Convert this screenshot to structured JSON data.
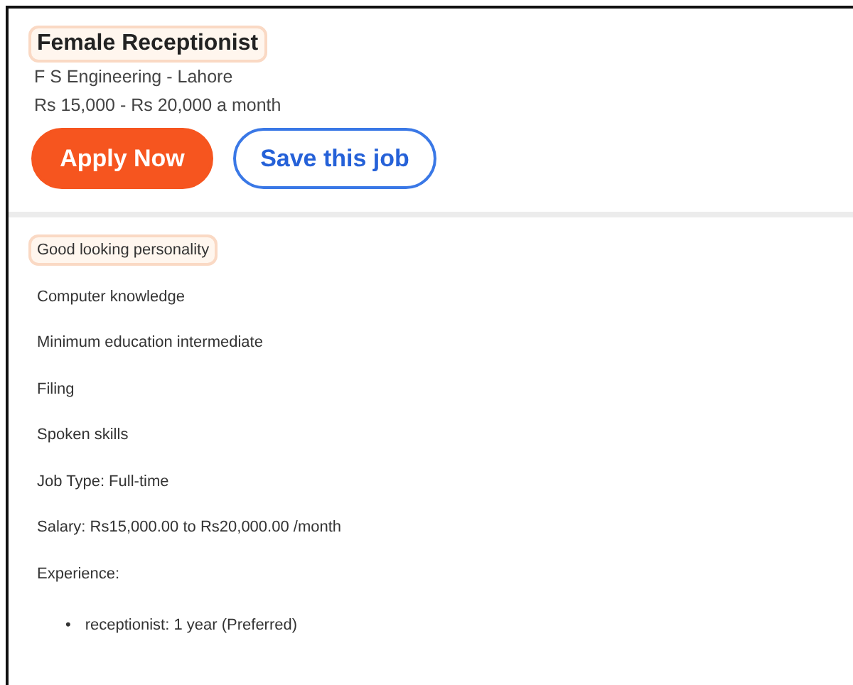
{
  "job": {
    "title": "Female Receptionist",
    "title_highlighted": true,
    "company": "F S Engineering - Lahore",
    "salary": "Rs 15,000 - Rs 20,000 a month"
  },
  "buttons": [
    {
      "kind": "primary",
      "label": "Apply Now"
    },
    {
      "kind": "outline",
      "label": "Save this job"
    }
  ],
  "description": [
    {
      "text": "Good looking personality",
      "highlighted": true
    },
    {
      "text": "Computer knowledge",
      "highlighted": false
    },
    {
      "text": "Minimum education intermediate",
      "highlighted": false
    },
    {
      "text": "Filing",
      "highlighted": false
    },
    {
      "text": "Spoken skills",
      "highlighted": false
    },
    {
      "text": "Job Type: Full-time",
      "highlighted": false
    },
    {
      "text": "Salary: Rs15,000.00 to Rs20,000.00 /month",
      "highlighted": false
    },
    {
      "text": "Experience:",
      "highlighted": false,
      "children": [
        {
          "bullet": "•",
          "text": "receptionist: 1 year (Preferred)"
        }
      ]
    }
  ]
}
